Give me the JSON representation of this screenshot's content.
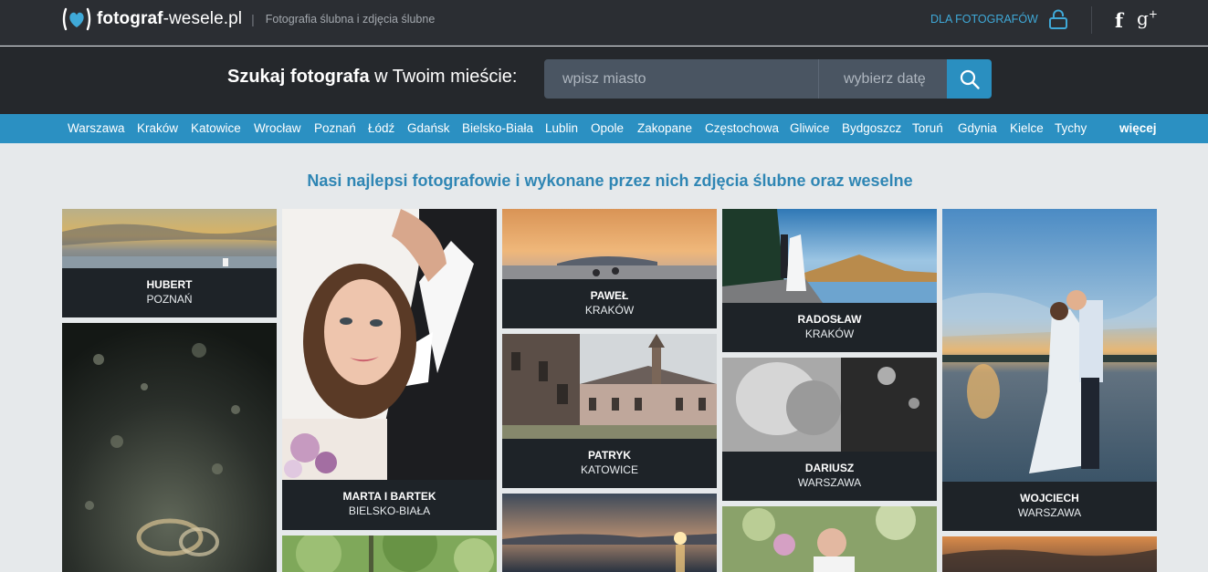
{
  "header": {
    "logo_bold": "fotograf",
    "logo_rest": "-wesele.pl",
    "separator": "|",
    "tagline": "Fotografia ślubna i zdjęcia ślubne",
    "for_photographers": "DLA FOTOGRAFÓW",
    "facebook": "f",
    "gplus": "g",
    "gplus_sup": "+"
  },
  "search": {
    "label_bold": "Szukaj fotografa",
    "label_rest": " w Twoim mieście:",
    "city_placeholder": "wpisz miasto",
    "date_placeholder": "wybierz datę"
  },
  "cities": [
    "Warszawa",
    "Kraków",
    "Katowice",
    "Wrocław",
    "Poznań",
    "Łódź",
    "Gdańsk",
    "Bielsko-Biała",
    "Lublin",
    "Opole",
    "Zakopane",
    "Częstochowa",
    "Gliwice",
    "Bydgoszcz",
    "Toruń",
    "Gdynia",
    "Kielce",
    "Tychy"
  ],
  "more_link": "więcej",
  "section_title": "Nasi najlepsi fotografowie i wykonane przez nich zdjęcia ślubne oraz weselne",
  "photographers": [
    {
      "name": "HUBERT",
      "city": "POZNAŃ"
    },
    {
      "name": "MARTA I BARTEK",
      "city": "BIELSKO-BIAŁA"
    },
    {
      "name": "PAWEŁ",
      "city": "KRAKÓW"
    },
    {
      "name": "PATRYK",
      "city": "KATOWICE"
    },
    {
      "name": "RADOSŁAW",
      "city": "KRAKÓW"
    },
    {
      "name": "DARIUSZ",
      "city": "WARSZAWA"
    },
    {
      "name": "WOJCIECH",
      "city": "WARSZAWA"
    }
  ],
  "colors": {
    "topbar": "#2b2e33",
    "searchbar": "#25282c",
    "accent": "#2b90c2",
    "title": "#2f86b4",
    "caption": "#1e2328"
  }
}
